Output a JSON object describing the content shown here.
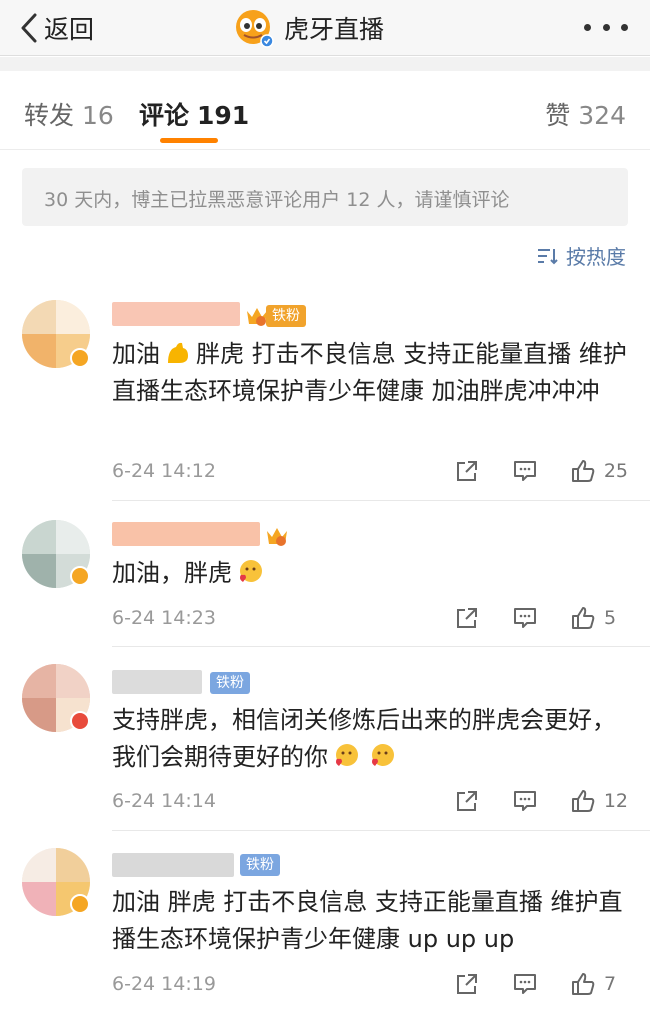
{
  "nav": {
    "back_label": "返回",
    "title": "虎牙直播",
    "more_icon": "more-dots-icon"
  },
  "tabs": [
    {
      "label": "转发",
      "count": "16"
    },
    {
      "label": "评论",
      "count": "191"
    },
    {
      "label": "赞",
      "count": "324"
    }
  ],
  "notice": "30 天内，博主已拉黑恶意评论用户 12 人，请谨慎评论",
  "sort_label": "按热度",
  "colors": {
    "accent": "#ff8200",
    "link": "#5a7ba8",
    "fan_orange": "#f1a32c",
    "fan_blue": "#7ba6e0",
    "verified": "#f5a623",
    "verified_red": "#e84b3c"
  },
  "comments": [
    {
      "fan_tag": "铁粉",
      "text_parts": [
        "加油",
        "胖虎  打击不良信息  支持正能量直播  维护直播生态环境保护青少年健康  加油胖虎冲冲冲"
      ],
      "time": "6-24 14:12",
      "likes": "25"
    },
    {
      "fan_tag": "",
      "text_parts": [
        "加油，胖虎"
      ],
      "time": "6-24 14:23",
      "likes": "5"
    },
    {
      "fan_tag": "铁粉",
      "text_parts": [
        "支持胖虎，相信闭关修炼后出来的胖虎会更好，我们会期待更好的你"
      ],
      "time": "6-24 14:14",
      "likes": "12"
    },
    {
      "fan_tag": "铁粉",
      "text_parts": [
        "加油 胖虎  打击不良信息  支持正能量直播  维护直播生态环境保护青少年健康  up up up"
      ],
      "time": "6-24 14:19",
      "likes": "7"
    }
  ]
}
